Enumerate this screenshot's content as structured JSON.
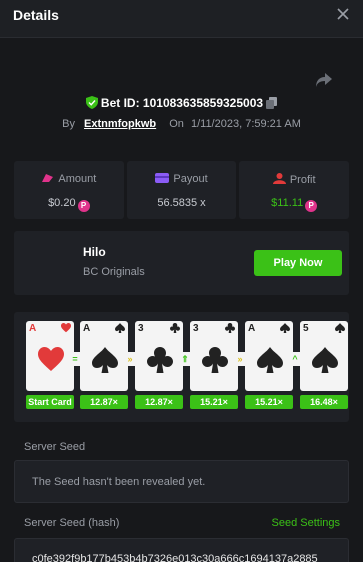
{
  "header": {
    "title": "Details"
  },
  "bet": {
    "id_label": "Bet ID: 101083635859325003",
    "by_label": "By",
    "username": "Extnmfopkwb",
    "on_label": "On",
    "datetime": "1/11/2023, 7:59:21 AM"
  },
  "stats": {
    "amount_label": "Amount",
    "amount_value": "$0.20",
    "payout_label": "Payout",
    "payout_value": "56.5835 x",
    "profit_label": "Profit",
    "profit_value": "$11.11"
  },
  "game": {
    "name": "Hilo",
    "provider": "BC Originals",
    "play_label": "Play Now"
  },
  "cards": [
    {
      "rank": "A",
      "suit": "heart",
      "multiplier": "Start Card"
    },
    {
      "rank": "A",
      "suit": "spade",
      "multiplier": "12.87×"
    },
    {
      "rank": "3",
      "suit": "club",
      "multiplier": "12.87×"
    },
    {
      "rank": "3",
      "suit": "club",
      "multiplier": "15.21×"
    },
    {
      "rank": "A",
      "suit": "spade",
      "multiplier": "15.21×"
    },
    {
      "rank": "5",
      "suit": "spade",
      "multiplier": "16.48×"
    }
  ],
  "arrows": [
    "=",
    "»",
    "⇑",
    "»",
    "^"
  ],
  "seed": {
    "server_seed_label": "Server Seed",
    "server_seed_value": "The Seed hasn't been revealed yet.",
    "hash_label": "Server Seed (hash)",
    "settings_link": "Seed Settings",
    "hash_value": "c0fe392f9b177b453b4b7326e013c30a666c1694137a2885"
  },
  "colors": {
    "accent": "#3bc117",
    "coin": "#e0338b",
    "background": "#17181b",
    "panel": "#1f2126"
  },
  "icons": [
    "close-icon",
    "share-icon",
    "shield-check-icon",
    "copy-icon",
    "coins-icon",
    "wallet-icon",
    "profit-icon",
    "coin-icon"
  ]
}
